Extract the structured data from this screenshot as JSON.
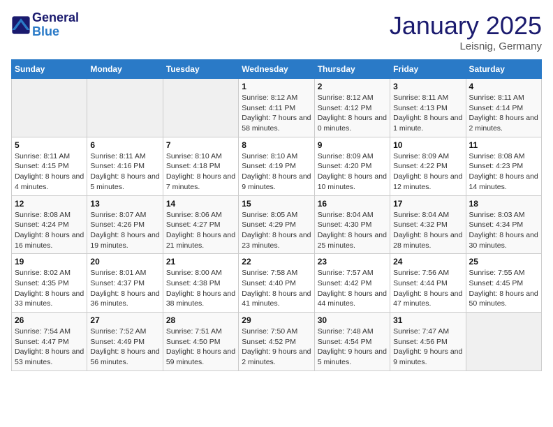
{
  "header": {
    "logo_line1": "General",
    "logo_line2": "Blue",
    "month": "January 2025",
    "location": "Leisnig, Germany"
  },
  "weekdays": [
    "Sunday",
    "Monday",
    "Tuesday",
    "Wednesday",
    "Thursday",
    "Friday",
    "Saturday"
  ],
  "weeks": [
    [
      {
        "day": "",
        "empty": true
      },
      {
        "day": "",
        "empty": true
      },
      {
        "day": "",
        "empty": true
      },
      {
        "day": "1",
        "sunrise": "Sunrise: 8:12 AM",
        "sunset": "Sunset: 4:11 PM",
        "daylight": "Daylight: 7 hours and 58 minutes."
      },
      {
        "day": "2",
        "sunrise": "Sunrise: 8:12 AM",
        "sunset": "Sunset: 4:12 PM",
        "daylight": "Daylight: 8 hours and 0 minutes."
      },
      {
        "day": "3",
        "sunrise": "Sunrise: 8:11 AM",
        "sunset": "Sunset: 4:13 PM",
        "daylight": "Daylight: 8 hours and 1 minute."
      },
      {
        "day": "4",
        "sunrise": "Sunrise: 8:11 AM",
        "sunset": "Sunset: 4:14 PM",
        "daylight": "Daylight: 8 hours and 2 minutes."
      }
    ],
    [
      {
        "day": "5",
        "sunrise": "Sunrise: 8:11 AM",
        "sunset": "Sunset: 4:15 PM",
        "daylight": "Daylight: 8 hours and 4 minutes."
      },
      {
        "day": "6",
        "sunrise": "Sunrise: 8:11 AM",
        "sunset": "Sunset: 4:16 PM",
        "daylight": "Daylight: 8 hours and 5 minutes."
      },
      {
        "day": "7",
        "sunrise": "Sunrise: 8:10 AM",
        "sunset": "Sunset: 4:18 PM",
        "daylight": "Daylight: 8 hours and 7 minutes."
      },
      {
        "day": "8",
        "sunrise": "Sunrise: 8:10 AM",
        "sunset": "Sunset: 4:19 PM",
        "daylight": "Daylight: 8 hours and 9 minutes."
      },
      {
        "day": "9",
        "sunrise": "Sunrise: 8:09 AM",
        "sunset": "Sunset: 4:20 PM",
        "daylight": "Daylight: 8 hours and 10 minutes."
      },
      {
        "day": "10",
        "sunrise": "Sunrise: 8:09 AM",
        "sunset": "Sunset: 4:22 PM",
        "daylight": "Daylight: 8 hours and 12 minutes."
      },
      {
        "day": "11",
        "sunrise": "Sunrise: 8:08 AM",
        "sunset": "Sunset: 4:23 PM",
        "daylight": "Daylight: 8 hours and 14 minutes."
      }
    ],
    [
      {
        "day": "12",
        "sunrise": "Sunrise: 8:08 AM",
        "sunset": "Sunset: 4:24 PM",
        "daylight": "Daylight: 8 hours and 16 minutes."
      },
      {
        "day": "13",
        "sunrise": "Sunrise: 8:07 AM",
        "sunset": "Sunset: 4:26 PM",
        "daylight": "Daylight: 8 hours and 19 minutes."
      },
      {
        "day": "14",
        "sunrise": "Sunrise: 8:06 AM",
        "sunset": "Sunset: 4:27 PM",
        "daylight": "Daylight: 8 hours and 21 minutes."
      },
      {
        "day": "15",
        "sunrise": "Sunrise: 8:05 AM",
        "sunset": "Sunset: 4:29 PM",
        "daylight": "Daylight: 8 hours and 23 minutes."
      },
      {
        "day": "16",
        "sunrise": "Sunrise: 8:04 AM",
        "sunset": "Sunset: 4:30 PM",
        "daylight": "Daylight: 8 hours and 25 minutes."
      },
      {
        "day": "17",
        "sunrise": "Sunrise: 8:04 AM",
        "sunset": "Sunset: 4:32 PM",
        "daylight": "Daylight: 8 hours and 28 minutes."
      },
      {
        "day": "18",
        "sunrise": "Sunrise: 8:03 AM",
        "sunset": "Sunset: 4:34 PM",
        "daylight": "Daylight: 8 hours and 30 minutes."
      }
    ],
    [
      {
        "day": "19",
        "sunrise": "Sunrise: 8:02 AM",
        "sunset": "Sunset: 4:35 PM",
        "daylight": "Daylight: 8 hours and 33 minutes."
      },
      {
        "day": "20",
        "sunrise": "Sunrise: 8:01 AM",
        "sunset": "Sunset: 4:37 PM",
        "daylight": "Daylight: 8 hours and 36 minutes."
      },
      {
        "day": "21",
        "sunrise": "Sunrise: 8:00 AM",
        "sunset": "Sunset: 4:38 PM",
        "daylight": "Daylight: 8 hours and 38 minutes."
      },
      {
        "day": "22",
        "sunrise": "Sunrise: 7:58 AM",
        "sunset": "Sunset: 4:40 PM",
        "daylight": "Daylight: 8 hours and 41 minutes."
      },
      {
        "day": "23",
        "sunrise": "Sunrise: 7:57 AM",
        "sunset": "Sunset: 4:42 PM",
        "daylight": "Daylight: 8 hours and 44 minutes."
      },
      {
        "day": "24",
        "sunrise": "Sunrise: 7:56 AM",
        "sunset": "Sunset: 4:44 PM",
        "daylight": "Daylight: 8 hours and 47 minutes."
      },
      {
        "day": "25",
        "sunrise": "Sunrise: 7:55 AM",
        "sunset": "Sunset: 4:45 PM",
        "daylight": "Daylight: 8 hours and 50 minutes."
      }
    ],
    [
      {
        "day": "26",
        "sunrise": "Sunrise: 7:54 AM",
        "sunset": "Sunset: 4:47 PM",
        "daylight": "Daylight: 8 hours and 53 minutes."
      },
      {
        "day": "27",
        "sunrise": "Sunrise: 7:52 AM",
        "sunset": "Sunset: 4:49 PM",
        "daylight": "Daylight: 8 hours and 56 minutes."
      },
      {
        "day": "28",
        "sunrise": "Sunrise: 7:51 AM",
        "sunset": "Sunset: 4:50 PM",
        "daylight": "Daylight: 8 hours and 59 minutes."
      },
      {
        "day": "29",
        "sunrise": "Sunrise: 7:50 AM",
        "sunset": "Sunset: 4:52 PM",
        "daylight": "Daylight: 9 hours and 2 minutes."
      },
      {
        "day": "30",
        "sunrise": "Sunrise: 7:48 AM",
        "sunset": "Sunset: 4:54 PM",
        "daylight": "Daylight: 9 hours and 5 minutes."
      },
      {
        "day": "31",
        "sunrise": "Sunrise: 7:47 AM",
        "sunset": "Sunset: 4:56 PM",
        "daylight": "Daylight: 9 hours and 9 minutes."
      },
      {
        "day": "",
        "empty": true
      }
    ]
  ]
}
